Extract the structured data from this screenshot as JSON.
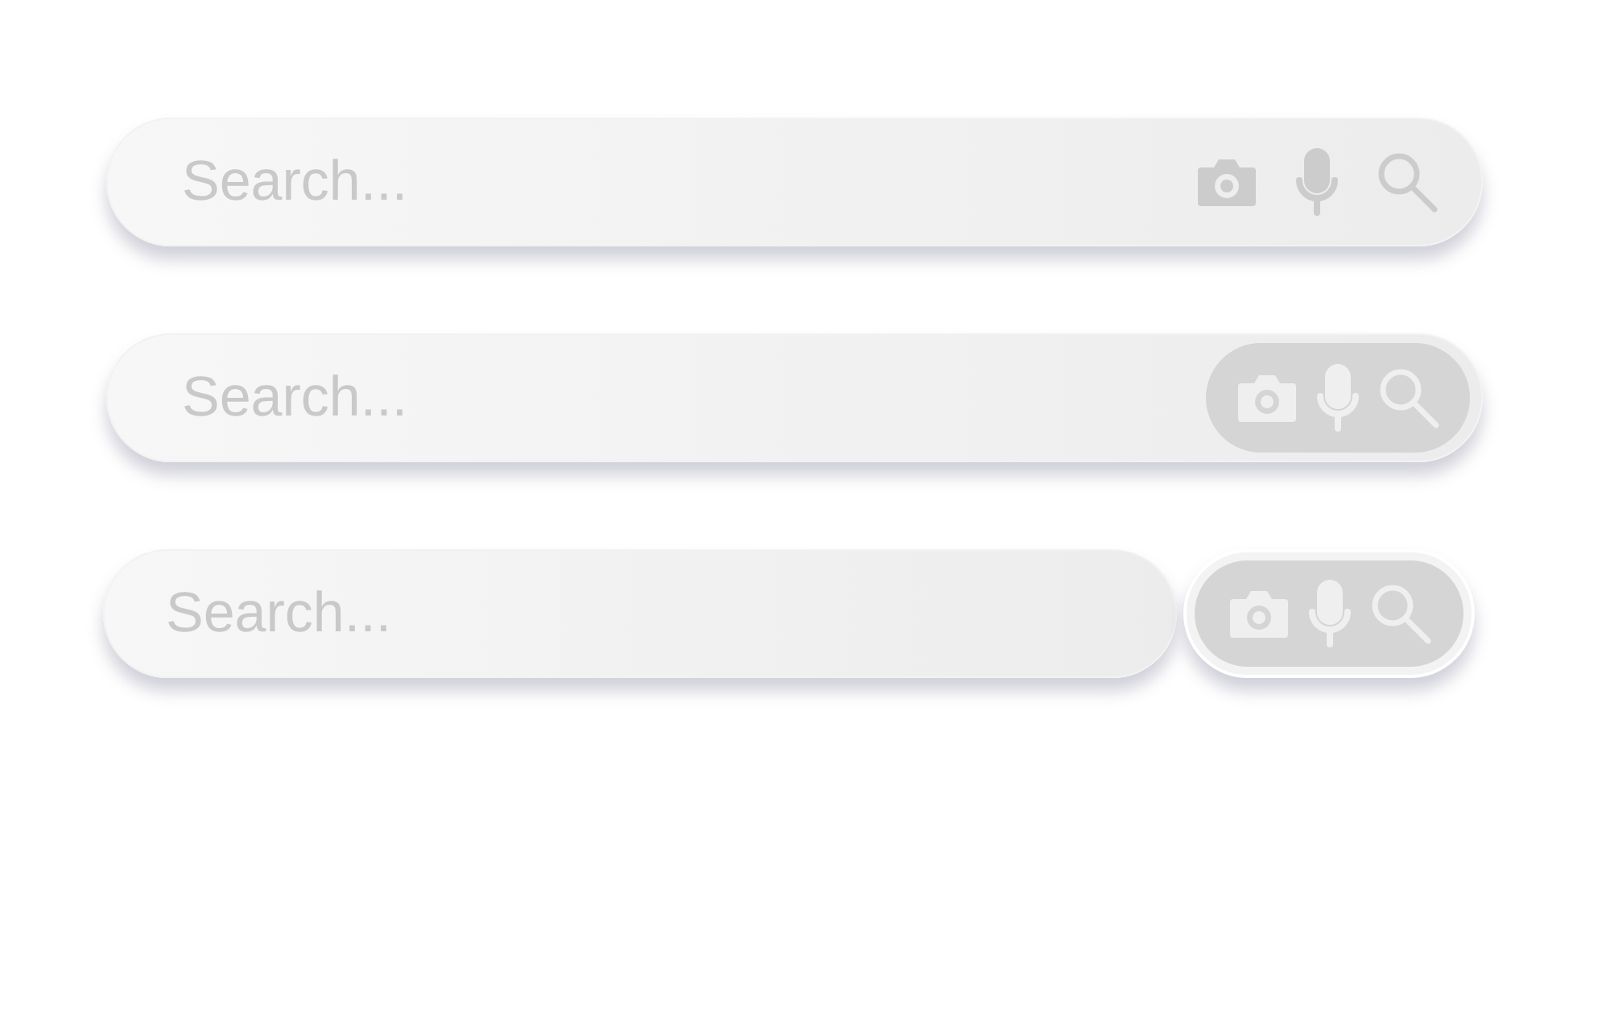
{
  "search_bars": [
    {
      "kind": "plain",
      "placeholder": "Search..."
    },
    {
      "kind": "inset",
      "placeholder": "Search..."
    },
    {
      "kind": "split",
      "placeholder": "Search..."
    }
  ]
}
